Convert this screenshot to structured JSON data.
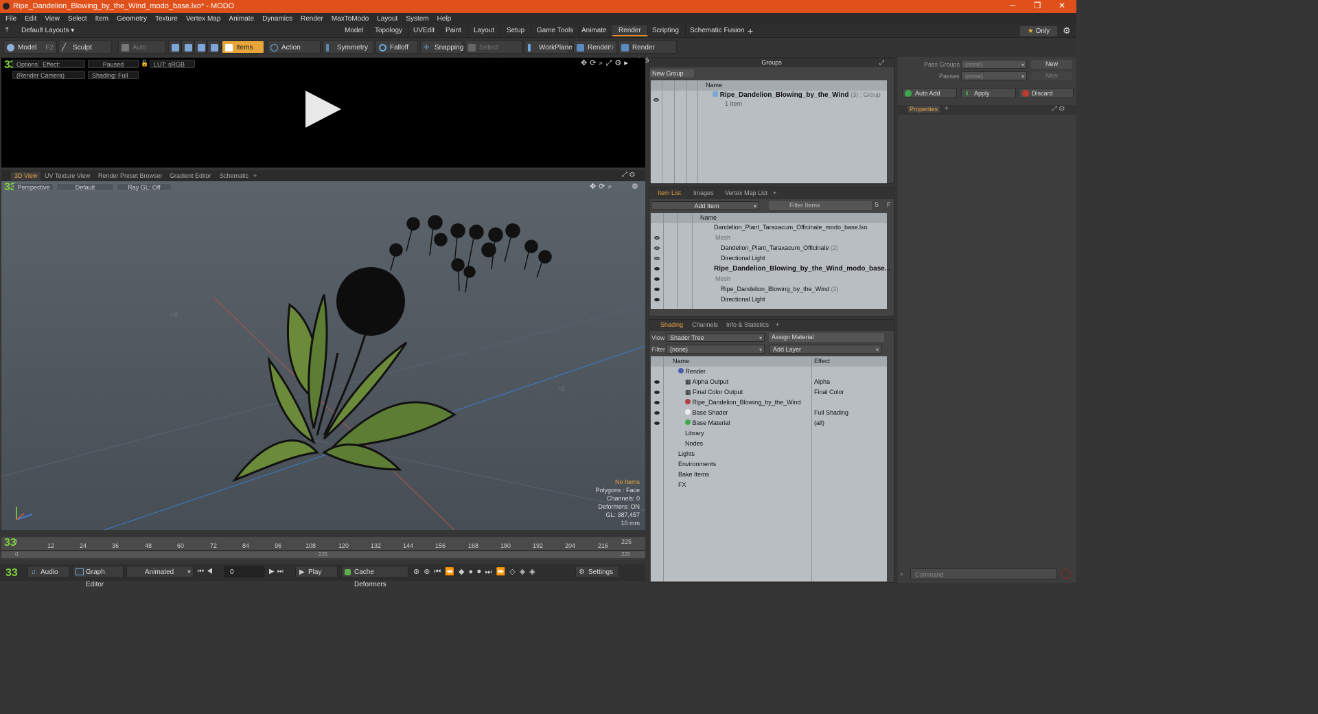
{
  "window": {
    "title": "Ripe_Dandelion_Blowing_by_the_Wind_modo_base.lxo* - MODO",
    "minimize": "─",
    "restore": "❐",
    "close": "✕"
  },
  "menu": [
    "File",
    "Edit",
    "View",
    "Select",
    "Item",
    "Geometry",
    "Texture",
    "Vertex Map",
    "Animate",
    "Dynamics",
    "Render",
    "MaxToModo",
    "Layout",
    "System",
    "Help"
  ],
  "layout_tabs": {
    "default": "Default Layouts",
    "tabs": [
      "Model",
      "Topology",
      "UVEdit",
      "Paint",
      "Layout",
      "Setup",
      "Game Tools",
      "Animate",
      "Render",
      "Scripting",
      "Schematic Fusion"
    ],
    "active": "Render",
    "plus": "+",
    "only": "Only"
  },
  "toolbar": {
    "model": "Model",
    "model_key": "F2",
    "sculpt": "Sculpt",
    "auto_select": "Auto Select",
    "items": "Items",
    "action_center": "Action Center",
    "symmetry": "Symmetry",
    "falloff": "Falloff",
    "snapping": "Snapping",
    "select_through": "Select Through",
    "workplane": "WorkPlane",
    "render": "Render",
    "render_key": "F9",
    "render_window": "Render Window"
  },
  "render_view": {
    "options": "Options",
    "effect": "Effect: (Shadi...",
    "paused": "Paused",
    "lut": "LUT: sRGB",
    "camera": "(Render Camera)",
    "shading": "Shading: Full"
  },
  "viewport_tabs": [
    "3D View",
    "UV Texture View",
    "Render Preset Browser",
    "Gradient Editor",
    "Schematic",
    "+"
  ],
  "viewport": {
    "perspective": "Perspective",
    "default": "Default",
    "raygl": "Ray GL: Off",
    "axis_x": "+X",
    "axis_z": "+Z"
  },
  "stats": {
    "no_items": "No Items",
    "polygons": "Polygons : Face",
    "channels": "Channels: 0",
    "deformers": "Deformers: ON",
    "gl": "GL: 387,457",
    "size": "10 mm"
  },
  "timeline": {
    "ticks": [
      "0",
      "12",
      "24",
      "36",
      "48",
      "60",
      "72",
      "84",
      "96",
      "108",
      "120",
      "132",
      "144",
      "156",
      "168",
      "180",
      "192",
      "204",
      "216",
      "225"
    ],
    "range_start": "0",
    "range_mid": "225",
    "range_end": "225"
  },
  "bottom": {
    "audio": "Audio",
    "graph_editor": "Graph Editor",
    "animated": "Animated",
    "frame": "0",
    "play": "Play",
    "cache_deformers": "Cache Deformers",
    "settings": "Settings"
  },
  "groups": {
    "title": "Groups",
    "new_group": "New Group",
    "name_col": "Name",
    "group_name": "Ripe_Dandelion_Blowing_by_the_Wind",
    "group_suffix": "(3) : Group",
    "group_items": "1 Item"
  },
  "item_list": {
    "tabs": [
      "Item List",
      "Images",
      "Vertex Map List",
      "+"
    ],
    "add_item": "Add Item",
    "filter": "Filter Items",
    "s": "S",
    "f": "F",
    "name_col": "Name",
    "rows": [
      {
        "label": "Dandelion_Plant_Taraxacum_Officinale_modo_base.lxo",
        "suffix": "",
        "indent": 0,
        "bold": false,
        "gray": false
      },
      {
        "label": "Mesh",
        "suffix": "",
        "indent": 2,
        "bold": false,
        "gray": true
      },
      {
        "label": "Dandelion_Plant_Taraxacum_Officinale",
        "suffix": "(2)",
        "indent": 1,
        "bold": false,
        "gray": false
      },
      {
        "label": "Directional Light",
        "suffix": "",
        "indent": 1,
        "bold": false,
        "gray": false
      },
      {
        "label": "Ripe_Dandelion_Blowing_by_the_Wind_modo_base...",
        "suffix": "",
        "indent": 0,
        "bold": true,
        "gray": false
      },
      {
        "label": "Mesh",
        "suffix": "",
        "indent": 2,
        "bold": false,
        "gray": true
      },
      {
        "label": "Ripe_Dandelion_Blowing_by_the_Wind",
        "suffix": "(2)",
        "indent": 1,
        "bold": false,
        "gray": false
      },
      {
        "label": "Directional Light",
        "suffix": "",
        "indent": 1,
        "bold": false,
        "gray": false
      }
    ]
  },
  "shading": {
    "tabs": [
      "Shading",
      "Channels",
      "Info & Statistics",
      "+"
    ],
    "view_label": "View",
    "view_value": "Shader Tree",
    "assign_material": "Assign Material",
    "filter_label": "Filter",
    "filter_value": "(none)",
    "add_layer": "Add Layer",
    "name_col": "Name",
    "effect_col": "Effect",
    "rows": [
      {
        "label": "Render",
        "effect": ""
      },
      {
        "label": "Alpha Output",
        "effect": "Alpha"
      },
      {
        "label": "Final Color Output",
        "effect": "Final Color"
      },
      {
        "label": "Ripe_Dandelion_Blowing_by_the_Wind",
        "effect": ""
      },
      {
        "label": "Base Shader",
        "effect": "Full Shading"
      },
      {
        "label": "Base Material",
        "effect": "(all)"
      },
      {
        "label": "Library",
        "effect": ""
      },
      {
        "label": "Nodes",
        "effect": ""
      },
      {
        "label": "Lights",
        "effect": ""
      },
      {
        "label": "Environments",
        "effect": ""
      },
      {
        "label": "Bake Items",
        "effect": ""
      },
      {
        "label": "FX",
        "effect": ""
      }
    ]
  },
  "passes": {
    "pass_groups_label": "Pass Groups",
    "pass_groups_value": "(none)",
    "passes_label": "Passes",
    "passes_value": "(none)",
    "new": "New",
    "auto_add": "Auto Add",
    "apply": "Apply",
    "discard": "Discard",
    "properties": "Properties",
    "plus": "+",
    "command": "Command"
  },
  "colors": {
    "accent": "#e0501a",
    "active_tab": "#e8a63a",
    "leaf": "#6b8a3a"
  }
}
